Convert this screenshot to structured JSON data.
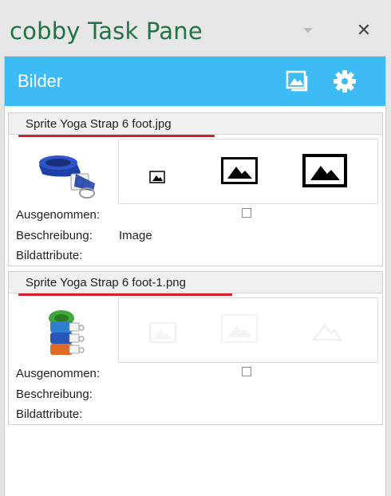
{
  "pane": {
    "title": "cobby Task Pane"
  },
  "header": {
    "title": "Bilder"
  },
  "images": [
    {
      "filename": "Sprite Yoga Strap 6 foot.jpg",
      "excluded_label": "Ausgenommen:",
      "description_label": "Beschreibung:",
      "description_value": "Image",
      "attributes_label": "Bildattribute:",
      "excluded": false
    },
    {
      "filename": "Sprite Yoga Strap 6 foot-1.png",
      "excluded_label": "Ausgenommen:",
      "description_label": "Beschreibung:",
      "description_value": "",
      "attributes_label": "Bildattribute:",
      "excluded": false
    }
  ],
  "colors": {
    "accent_green": "#217346",
    "header_blue": "#3dbbf5",
    "underline_red": "#d4202a"
  },
  "icons": [
    "chevron-down-icon",
    "close-icon",
    "image-gallery-icon",
    "gear-icon",
    "image-small-icon",
    "image-medium-icon",
    "image-large-icon"
  ]
}
